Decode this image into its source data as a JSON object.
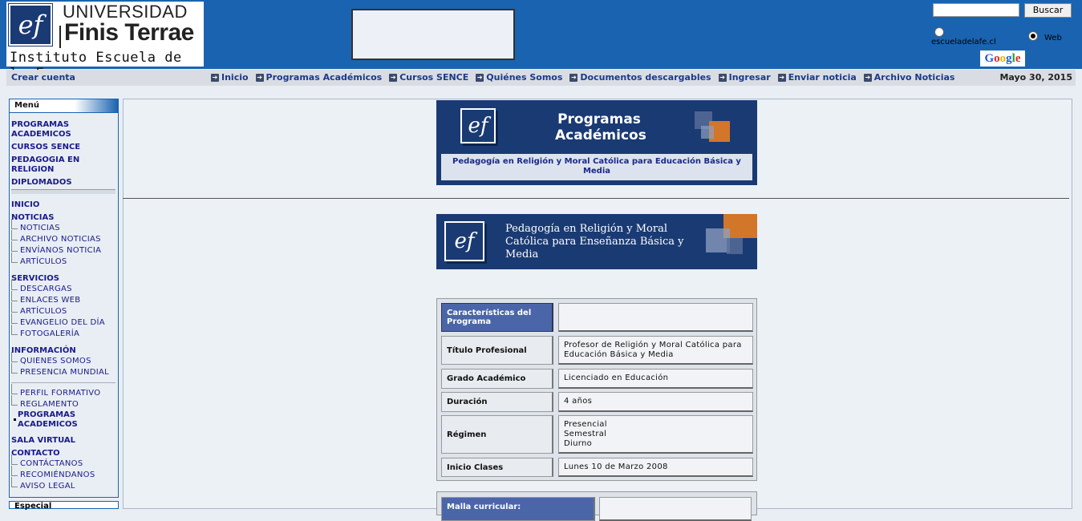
{
  "header": {
    "logo_ef": "ef",
    "logo_line1": "UNIVERSIDAD",
    "logo_line2": "Finis Terrae",
    "logo_line3": "Instituto Escuela de la Fe",
    "search_button": "Buscar",
    "search_value": "",
    "radio_site": "escueladelafe.cl",
    "radio_web": "Web",
    "google": "Google"
  },
  "navbar": {
    "create_account": "Crear cuenta",
    "links": [
      "Inicio",
      "Programas Académicos",
      "Cursos SENCE",
      "Quiénes Somos",
      "Documentos descargables",
      "Ingresar",
      "Enviar noticia",
      "Archivo Noticias"
    ],
    "date": "Mayo 30, 2015"
  },
  "sidebar": {
    "title": "Menú",
    "top_items": [
      "PROGRAMAS ACADEMICOS",
      "CURSOS SENCE",
      "PEDAGOGIA EN RELIGION",
      "DIPLOMADOS"
    ],
    "inicio": "INICIO",
    "noticias": "NOTICIAS",
    "noticias_sub": [
      "NOTICIAS",
      "ARCHIVO NOTICIAS",
      "ENVÍANOS NOTICIA",
      "ARTÍCULOS"
    ],
    "servicios": "SERVICIOS",
    "servicios_sub": [
      "DESCARGAS",
      "ENLACES WEB",
      "ARTÍCULOS",
      "EVANGELIO DEL DÍA",
      "FOTOGALERÍA"
    ],
    "informacion": "INFORMACIÓN",
    "informacion_sub": [
      "QUIENES SOMOS",
      "PRESENCIA MUNDIAL"
    ],
    "extra_sub": [
      "PERFIL FORMATIVO",
      "REGLAMENTO"
    ],
    "programas_active": "PROGRAMAS ACADEMICOS",
    "sala": "SALA VIRTUAL",
    "contacto": "CONTACTO",
    "contacto_sub": [
      "CONTÁCTANOS",
      "RECOMIÉNDANOS",
      "AVISO LEGAL"
    ],
    "box2_title": "Especial"
  },
  "card1": {
    "title": "Programas Académicos",
    "subtitle": "Pedagogía en Religión y Moral Católica para Educación Básica y Media"
  },
  "card2": {
    "title": "Pedagogía en Religión y Moral Católica para Enseñanza Básica y Media"
  },
  "table": {
    "rows": [
      {
        "label": "Características del Programa",
        "value": ""
      },
      {
        "label": "Título Profesional",
        "value": "Profesor de Religión y Moral Católica para Educación Básica y Media"
      },
      {
        "label": "Grado Académico",
        "value": "Licenciado en Educación"
      },
      {
        "label": "Duración",
        "value": "4 años"
      },
      {
        "label": "Régimen",
        "value": "Presencial\nSemestral\nDiurno"
      },
      {
        "label": "Inicio Clases",
        "value": "Lunes 10 de Marzo 2008"
      }
    ],
    "malla": "Malla curricular:"
  },
  "colors": {
    "header_blue": "#1a63b0",
    "card_navy": "#1a3a73",
    "label_blue": "#4a66a8",
    "accent_orange": "#d2762a"
  }
}
